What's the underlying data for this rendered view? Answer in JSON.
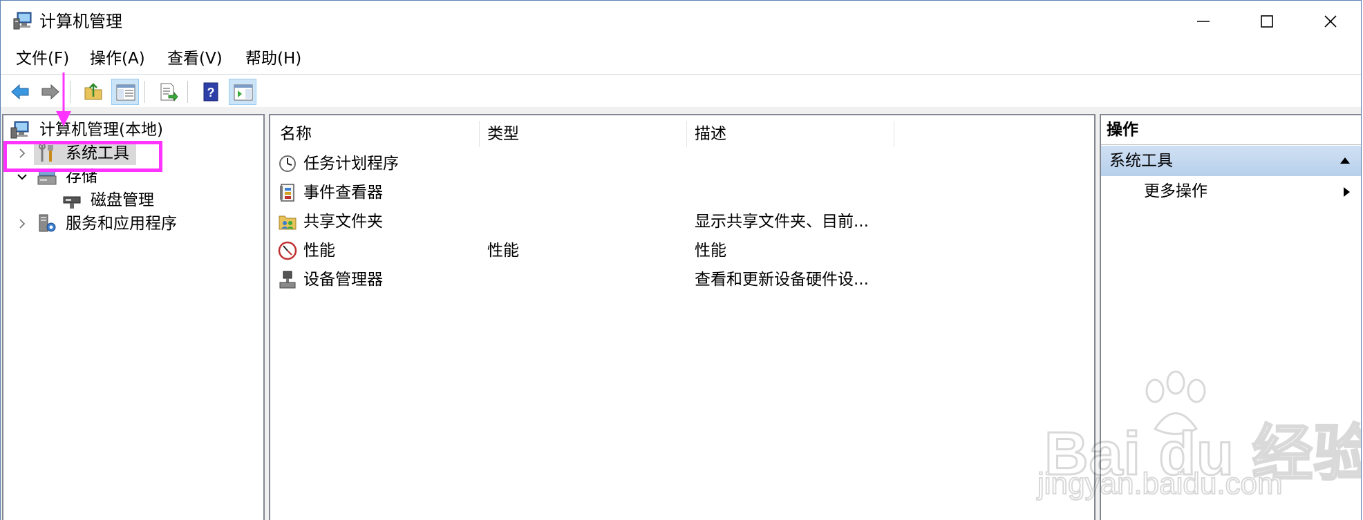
{
  "window": {
    "title": "计算机管理"
  },
  "menu": {
    "file": "文件(F)",
    "action": "操作(A)",
    "view": "查看(V)",
    "help": "帮助(H)"
  },
  "tree": {
    "root": "计算机管理(本地)",
    "items": [
      {
        "label": "系统工具"
      },
      {
        "label": "存储"
      },
      {
        "label": "磁盘管理"
      },
      {
        "label": "服务和应用程序"
      }
    ]
  },
  "list": {
    "columns": [
      "名称",
      "类型",
      "描述"
    ],
    "rows": [
      {
        "name": "任务计划程序",
        "type": "",
        "desc": "",
        "icon": "clock-icon"
      },
      {
        "name": "事件查看器",
        "type": "",
        "desc": "",
        "icon": "event-log-icon"
      },
      {
        "name": "共享文件夹",
        "type": "",
        "desc": "显示共享文件夹、目前...",
        "icon": "shared-folder-icon"
      },
      {
        "name": "性能",
        "type": "性能",
        "desc": "性能",
        "icon": "performance-gauge-icon"
      },
      {
        "name": "设备管理器",
        "type": "",
        "desc": "查看和更新设备硬件设...",
        "icon": "device-manager-icon"
      }
    ]
  },
  "actions": {
    "header": "操作",
    "group": "系统工具",
    "more": "更多操作"
  },
  "watermark": {
    "brand": "Bai du 经验",
    "url": "jingyan.baidu.com"
  },
  "colors": {
    "highlight": "#ff33ff",
    "selection": "#d9d9d9",
    "actions_group": "#c3d7ef"
  }
}
